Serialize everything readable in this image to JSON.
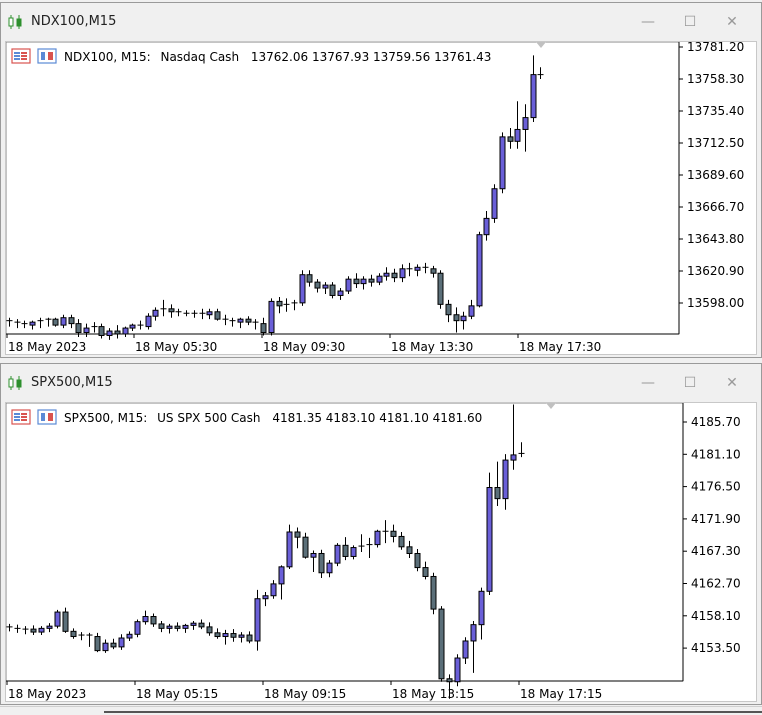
{
  "windows": [
    {
      "title": "NDX100,M15",
      "info": {
        "symbol_period": "NDX100, M15:",
        "description": "Nasdaq Cash",
        "ohlc": "13762.06 13767.93 13759.56 13761.43"
      },
      "price_labels": [
        "13781.20",
        "13758.30",
        "13735.40",
        "13712.50",
        "13689.60",
        "13666.70",
        "13643.80",
        "13620.90",
        "13598.00"
      ],
      "time_labels": [
        "18 May 2023",
        "18 May 05:30",
        "18 May 09:30",
        "18 May 13:30",
        "18 May 17:30"
      ],
      "chart_data": {
        "type": "candlestick",
        "ylim": [
          13587,
          13784
        ],
        "candles": [
          [
            13596,
            13598,
            13592,
            13595
          ],
          [
            13595,
            13597,
            13591,
            13594
          ],
          [
            13594,
            13596,
            13591,
            13593
          ],
          [
            13593,
            13596,
            13590,
            13595
          ],
          [
            13595,
            13598,
            13591,
            13596
          ],
          [
            13596,
            13598,
            13592,
            13597
          ],
          [
            13597,
            13598,
            13592,
            13593
          ],
          [
            13593,
            13600,
            13591,
            13598
          ],
          [
            13598,
            13600,
            13591,
            13594
          ],
          [
            13594,
            13597,
            13585,
            13588
          ],
          [
            13588,
            13594,
            13585,
            13591
          ],
          [
            13591,
            13595,
            13588,
            13592
          ],
          [
            13592,
            13594,
            13584,
            13586
          ],
          [
            13586,
            13591,
            13583,
            13589
          ],
          [
            13589,
            13593,
            13584,
            13587
          ],
          [
            13587,
            13592,
            13585,
            13591
          ],
          [
            13591,
            13594,
            13589,
            13593
          ],
          [
            13593,
            13596,
            13590,
            13592
          ],
          [
            13592,
            13601,
            13590,
            13599
          ],
          [
            13599,
            13605,
            13596,
            13603
          ],
          [
            13603,
            13610,
            13599,
            13604
          ],
          [
            13604,
            13607,
            13598,
            13602
          ],
          [
            13602,
            13604,
            13599,
            13601
          ],
          [
            13601,
            13603,
            13599,
            13600
          ],
          [
            13600,
            13603,
            13598,
            13601
          ],
          [
            13601,
            13604,
            13597,
            13600
          ],
          [
            13600,
            13604,
            13597,
            13602
          ],
          [
            13602,
            13604,
            13596,
            13597
          ],
          [
            13597,
            13600,
            13593,
            13596
          ],
          [
            13596,
            13598,
            13592,
            13595
          ],
          [
            13595,
            13598,
            13591,
            13597
          ],
          [
            13597,
            13599,
            13593,
            13595
          ],
          [
            13595,
            13597,
            13590,
            13594
          ],
          [
            13594,
            13598,
            13586,
            13588
          ],
          [
            13588,
            13611,
            13586,
            13609
          ],
          [
            13609,
            13612,
            13601,
            13606
          ],
          [
            13606,
            13611,
            13602,
            13607
          ],
          [
            13607,
            13610,
            13603,
            13608
          ],
          [
            13608,
            13630,
            13606,
            13627
          ],
          [
            13627,
            13630,
            13619,
            13622
          ],
          [
            13622,
            13624,
            13615,
            13618
          ],
          [
            13618,
            13622,
            13614,
            13620
          ],
          [
            13620,
            13622,
            13611,
            13613
          ],
          [
            13613,
            13618,
            13610,
            13616
          ],
          [
            13616,
            13626,
            13614,
            13624
          ],
          [
            13624,
            13628,
            13618,
            13621
          ],
          [
            13621,
            13626,
            13617,
            13624
          ],
          [
            13624,
            13627,
            13619,
            13622
          ],
          [
            13622,
            13628,
            13620,
            13626
          ],
          [
            13626,
            13632,
            13623,
            13628
          ],
          [
            13628,
            13631,
            13622,
            13625
          ],
          [
            13625,
            13634,
            13622,
            13631
          ],
          [
            13631,
            13635,
            13626,
            13630
          ],
          [
            13630,
            13634,
            13626,
            13632
          ],
          [
            13632,
            13635,
            13628,
            13631
          ],
          [
            13631,
            13633,
            13625,
            13628
          ],
          [
            13628,
            13630,
            13604,
            13607
          ],
          [
            13607,
            13610,
            13595,
            13600
          ],
          [
            13600,
            13605,
            13588,
            13596
          ],
          [
            13596,
            13602,
            13590,
            13599
          ],
          [
            13599,
            13610,
            13597,
            13606
          ],
          [
            13606,
            13656,
            13605,
            13654
          ],
          [
            13654,
            13670,
            13650,
            13665
          ],
          [
            13665,
            13688,
            13662,
            13685
          ],
          [
            13685,
            13723,
            13682,
            13720
          ],
          [
            13720,
            13726,
            13712,
            13717
          ],
          [
            13717,
            13744,
            13712,
            13725
          ],
          [
            13725,
            13742,
            13710,
            13733
          ],
          [
            13733,
            13775,
            13730,
            13762
          ],
          [
            13762,
            13767,
            13759,
            13761
          ]
        ]
      }
    },
    {
      "title": "SPX500,M15",
      "info": {
        "symbol_period": "SPX500, M15:",
        "description": "US SPX 500 Cash",
        "ohlc": "4181.35 4183.10 4181.10 4181.60"
      },
      "price_labels": [
        "4185.70",
        "4181.10",
        "4176.50",
        "4171.90",
        "4167.30",
        "4162.70",
        "4158.10",
        "4153.50"
      ],
      "time_labels": [
        "18 May 2023",
        "18 May 05:15",
        "18 May 09:15",
        "18 May 13:15",
        "18 May 17:15"
      ],
      "chart_data": {
        "type": "candlestick",
        "ylim": [
          4150.9,
          4188.4
        ],
        "candles": [
          [
            4158.2,
            4158.6,
            4157.6,
            4158.0
          ],
          [
            4158.0,
            4158.5,
            4157.4,
            4157.8
          ],
          [
            4157.8,
            4158.3,
            4157.2,
            4157.9
          ],
          [
            4157.9,
            4158.4,
            4157.1,
            4157.5
          ],
          [
            4157.5,
            4158.3,
            4157.1,
            4158.0
          ],
          [
            4158.0,
            4158.7,
            4157.5,
            4158.3
          ],
          [
            4158.3,
            4160.5,
            4158.0,
            4160.2
          ],
          [
            4160.2,
            4160.8,
            4157.4,
            4157.6
          ],
          [
            4157.6,
            4158.0,
            4156.6,
            4156.9
          ],
          [
            4156.9,
            4157.5,
            4156.4,
            4157.1
          ],
          [
            4157.1,
            4157.4,
            4155.5,
            4156.9
          ],
          [
            4156.9,
            4157.4,
            4154.8,
            4155.0
          ],
          [
            4155.0,
            4156.5,
            4154.7,
            4156.0
          ],
          [
            4156.0,
            4156.6,
            4155.2,
            4155.5
          ],
          [
            4155.5,
            4157.2,
            4155.1,
            4156.7
          ],
          [
            4156.7,
            4157.6,
            4156.3,
            4157.2
          ],
          [
            4157.2,
            4159.2,
            4156.8,
            4158.9
          ],
          [
            4158.9,
            4160.4,
            4158.5,
            4159.6
          ],
          [
            4159.6,
            4160.0,
            4158.2,
            4158.6
          ],
          [
            4158.6,
            4159.0,
            4157.5,
            4158.0
          ],
          [
            4158.0,
            4158.6,
            4157.3,
            4158.3
          ],
          [
            4158.3,
            4158.8,
            4157.6,
            4158.0
          ],
          [
            4158.0,
            4158.6,
            4157.4,
            4158.4
          ],
          [
            4158.4,
            4159.0,
            4157.8,
            4158.7
          ],
          [
            4158.7,
            4159.2,
            4157.9,
            4158.2
          ],
          [
            4158.2,
            4158.8,
            4157.0,
            4157.4
          ],
          [
            4157.4,
            4158.0,
            4156.6,
            4156.9
          ],
          [
            4156.9,
            4157.8,
            4155.8,
            4157.3
          ],
          [
            4157.3,
            4157.9,
            4156.2,
            4156.8
          ],
          [
            4156.8,
            4157.5,
            4156.1,
            4157.1
          ],
          [
            4157.1,
            4157.6,
            4156.0,
            4156.3
          ],
          [
            4156.3,
            4163.2,
            4155.0,
            4162.0
          ],
          [
            4162.0,
            4162.9,
            4161.0,
            4162.4
          ],
          [
            4162.4,
            4164.5,
            4162.0,
            4164.0
          ],
          [
            4164.0,
            4166.5,
            4161.9,
            4166.3
          ],
          [
            4166.3,
            4172.0,
            4166.0,
            4171.0
          ],
          [
            4171.0,
            4171.6,
            4168.8,
            4170.3
          ],
          [
            4170.3,
            4170.9,
            4167.4,
            4167.6
          ],
          [
            4167.6,
            4168.5,
            4165.6,
            4168.1
          ],
          [
            4168.1,
            4168.6,
            4164.8,
            4165.5
          ],
          [
            4165.5,
            4167.2,
            4164.9,
            4166.8
          ],
          [
            4166.8,
            4169.5,
            4166.4,
            4169.2
          ],
          [
            4169.2,
            4170.3,
            4167.2,
            4167.7
          ],
          [
            4167.7,
            4169.2,
            4167.3,
            4168.9
          ],
          [
            4168.9,
            4170.7,
            4168.3,
            4169.1
          ],
          [
            4169.1,
            4170.2,
            4167.5,
            4169.3
          ],
          [
            4169.3,
            4171.3,
            4168.9,
            4171.1
          ],
          [
            4171.1,
            4172.6,
            4169.5,
            4171.1
          ],
          [
            4171.1,
            4172.0,
            4169.6,
            4170.4
          ],
          [
            4170.4,
            4171.0,
            4168.6,
            4169.0
          ],
          [
            4169.0,
            4169.8,
            4167.5,
            4168.1
          ],
          [
            4168.1,
            4168.7,
            4165.7,
            4166.2
          ],
          [
            4166.2,
            4167.0,
            4164.6,
            4165.0
          ],
          [
            4165.0,
            4165.5,
            4159.9,
            4160.6
          ],
          [
            4160.6,
            4161.0,
            4150.8,
            4151.2
          ],
          [
            4151.2,
            4151.8,
            4148.5,
            4150.8
          ],
          [
            4150.8,
            4154.5,
            4150.2,
            4154.0
          ],
          [
            4154.0,
            4156.8,
            4153.2,
            4156.3
          ],
          [
            4156.3,
            4159.0,
            4152.0,
            4158.5
          ],
          [
            4158.5,
            4163.5,
            4156.5,
            4163.0
          ],
          [
            4163.0,
            4179.0,
            4162.5,
            4177.0
          ],
          [
            4177.0,
            4180.5,
            4174.5,
            4175.5
          ],
          [
            4175.5,
            4181.5,
            4174.0,
            4180.7
          ],
          [
            4180.7,
            4188.2,
            4179.4,
            4181.4
          ],
          [
            4181.4,
            4183.1,
            4181.1,
            4181.6
          ]
        ]
      }
    }
  ],
  "colors": {
    "bull_body": "#6a5fd8",
    "bear_body": "#5b6f79",
    "wick": "#000000",
    "grid_border": "#c8c8c8",
    "background": "#ffffff"
  }
}
